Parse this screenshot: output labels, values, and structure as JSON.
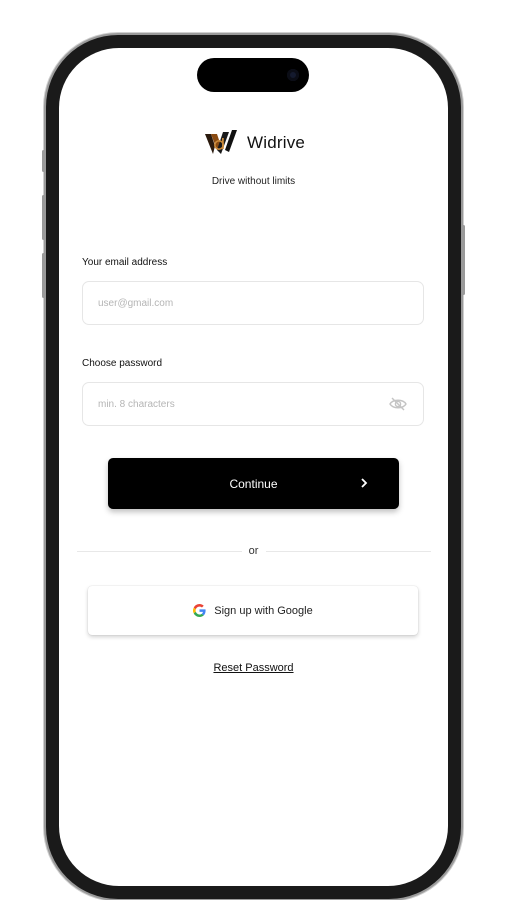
{
  "app": {
    "brand_name": "Widrive",
    "tagline": "Drive without limits",
    "brand_color": "#8a4b12"
  },
  "form": {
    "email": {
      "label": "Your email address",
      "placeholder": "user@gmail.com",
      "value": ""
    },
    "password": {
      "label": "Choose password",
      "placeholder": "min. 8 characters",
      "value": "",
      "toggle_icon": "eye-off-icon"
    },
    "continue_label": "Continue",
    "continue_icon": "chevron-right-icon"
  },
  "separator": {
    "text": "or"
  },
  "social": {
    "google_label": "Sign up with Google",
    "google_icon": "google-logo-icon"
  },
  "links": {
    "reset_password": "Reset Password"
  }
}
